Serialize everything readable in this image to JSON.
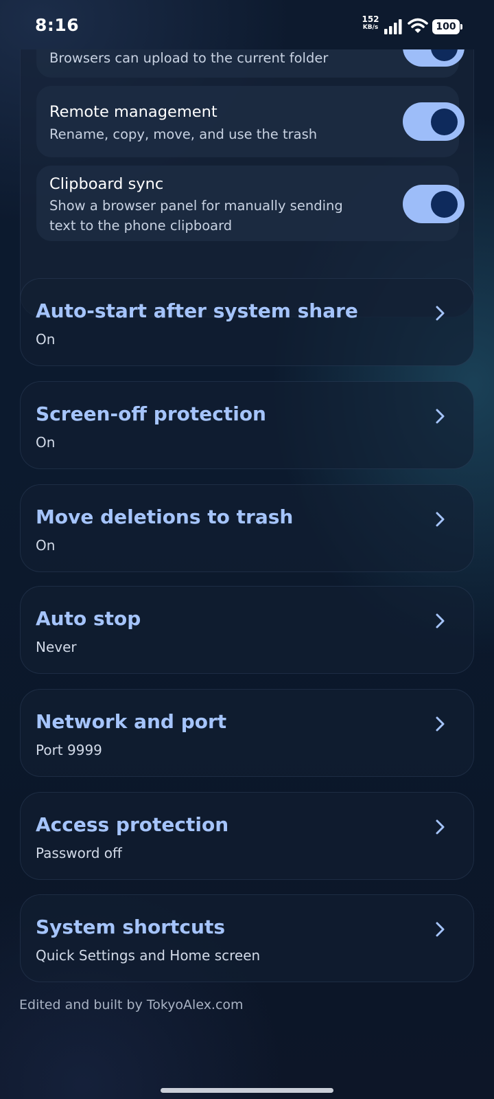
{
  "status_bar": {
    "time": "8:16",
    "net_speed_value": "152",
    "net_speed_unit": "KB/s",
    "battery": "100",
    "icons": [
      "signal-icon",
      "wifi-icon",
      "battery-icon"
    ]
  },
  "toggles": [
    {
      "title": "",
      "subtitle": "Browsers can upload to the current folder",
      "on": true
    },
    {
      "title": "Remote management",
      "subtitle": "Rename, copy, move, and use the trash",
      "on": true
    },
    {
      "title": "Clipboard sync",
      "subtitle": "Show a browser panel for manually sending text to the phone clipboard",
      "on": true
    }
  ],
  "settings": [
    {
      "title": "Auto-start after system share",
      "value": "On"
    },
    {
      "title": "Screen-off protection",
      "value": "On"
    },
    {
      "title": "Move deletions to trash",
      "value": "On"
    },
    {
      "title": "Auto stop",
      "value": "Never"
    },
    {
      "title": "Network and port",
      "value": "Port 9999"
    },
    {
      "title": "Access protection",
      "value": "Password off"
    },
    {
      "title": "System shortcuts",
      "value": "Quick Settings and Home screen"
    }
  ],
  "footer": {
    "credit": "Edited and built by TokyoAlex.com"
  },
  "colors": {
    "accent": "#a5c4fb",
    "switch_track": "#9dbdf9",
    "switch_knob": "#0e2a5c",
    "background": "#0c1a2e"
  }
}
